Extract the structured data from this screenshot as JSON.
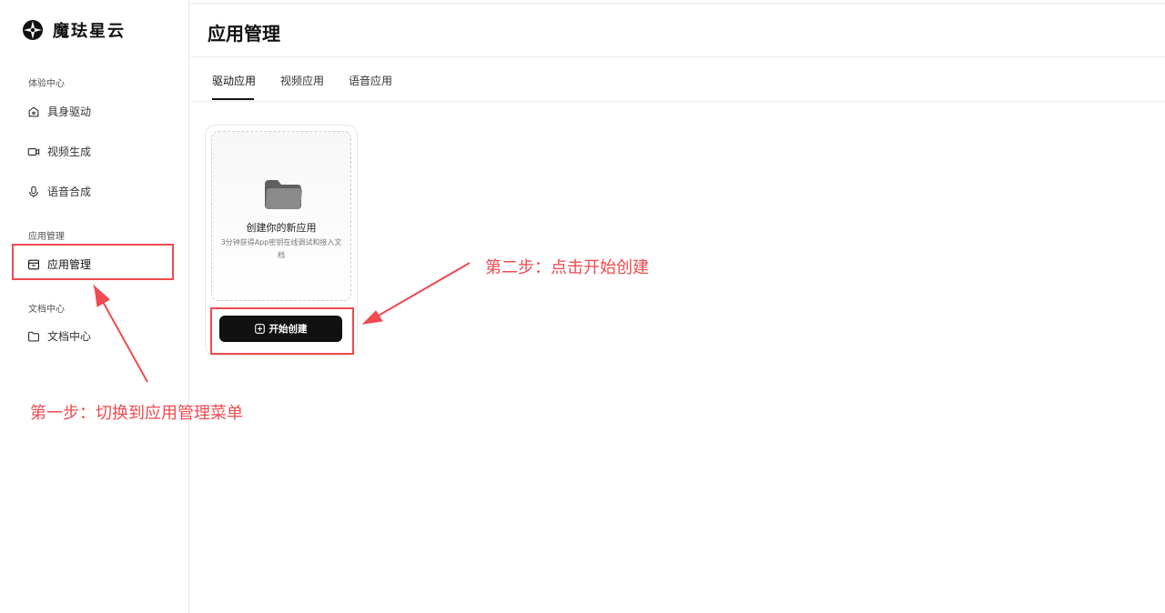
{
  "app": {
    "name": "魔珐星云"
  },
  "sidebar": {
    "sections": [
      {
        "title": "体验中心",
        "items": [
          {
            "label": "具身驱动",
            "icon": "home-icon"
          },
          {
            "label": "视频生成",
            "icon": "video-camera-icon"
          },
          {
            "label": "语音合成",
            "icon": "microphone-icon"
          }
        ]
      },
      {
        "title": "应用管理",
        "items": [
          {
            "label": "应用管理",
            "icon": "archive-box-icon",
            "active": true
          }
        ]
      },
      {
        "title": "文档中心",
        "items": [
          {
            "label": "文档中心",
            "icon": "folder-icon"
          }
        ]
      }
    ]
  },
  "main": {
    "title": "应用管理",
    "tabs": [
      {
        "label": "驱动应用",
        "active": true
      },
      {
        "label": "视频应用"
      },
      {
        "label": "语音应用"
      }
    ],
    "create_card": {
      "title": "创建你的新应用",
      "description": "3分钟获得App密钥在线调试和接入文档",
      "button_label": "开始创建",
      "icon": "folder-icon"
    }
  },
  "annotations": {
    "step1": "第一步：切换到应用管理菜单",
    "step2": "第二步：点击开始创建"
  },
  "colors": {
    "annotation_red": "#ef4a4f",
    "primary_button": "#111111"
  }
}
